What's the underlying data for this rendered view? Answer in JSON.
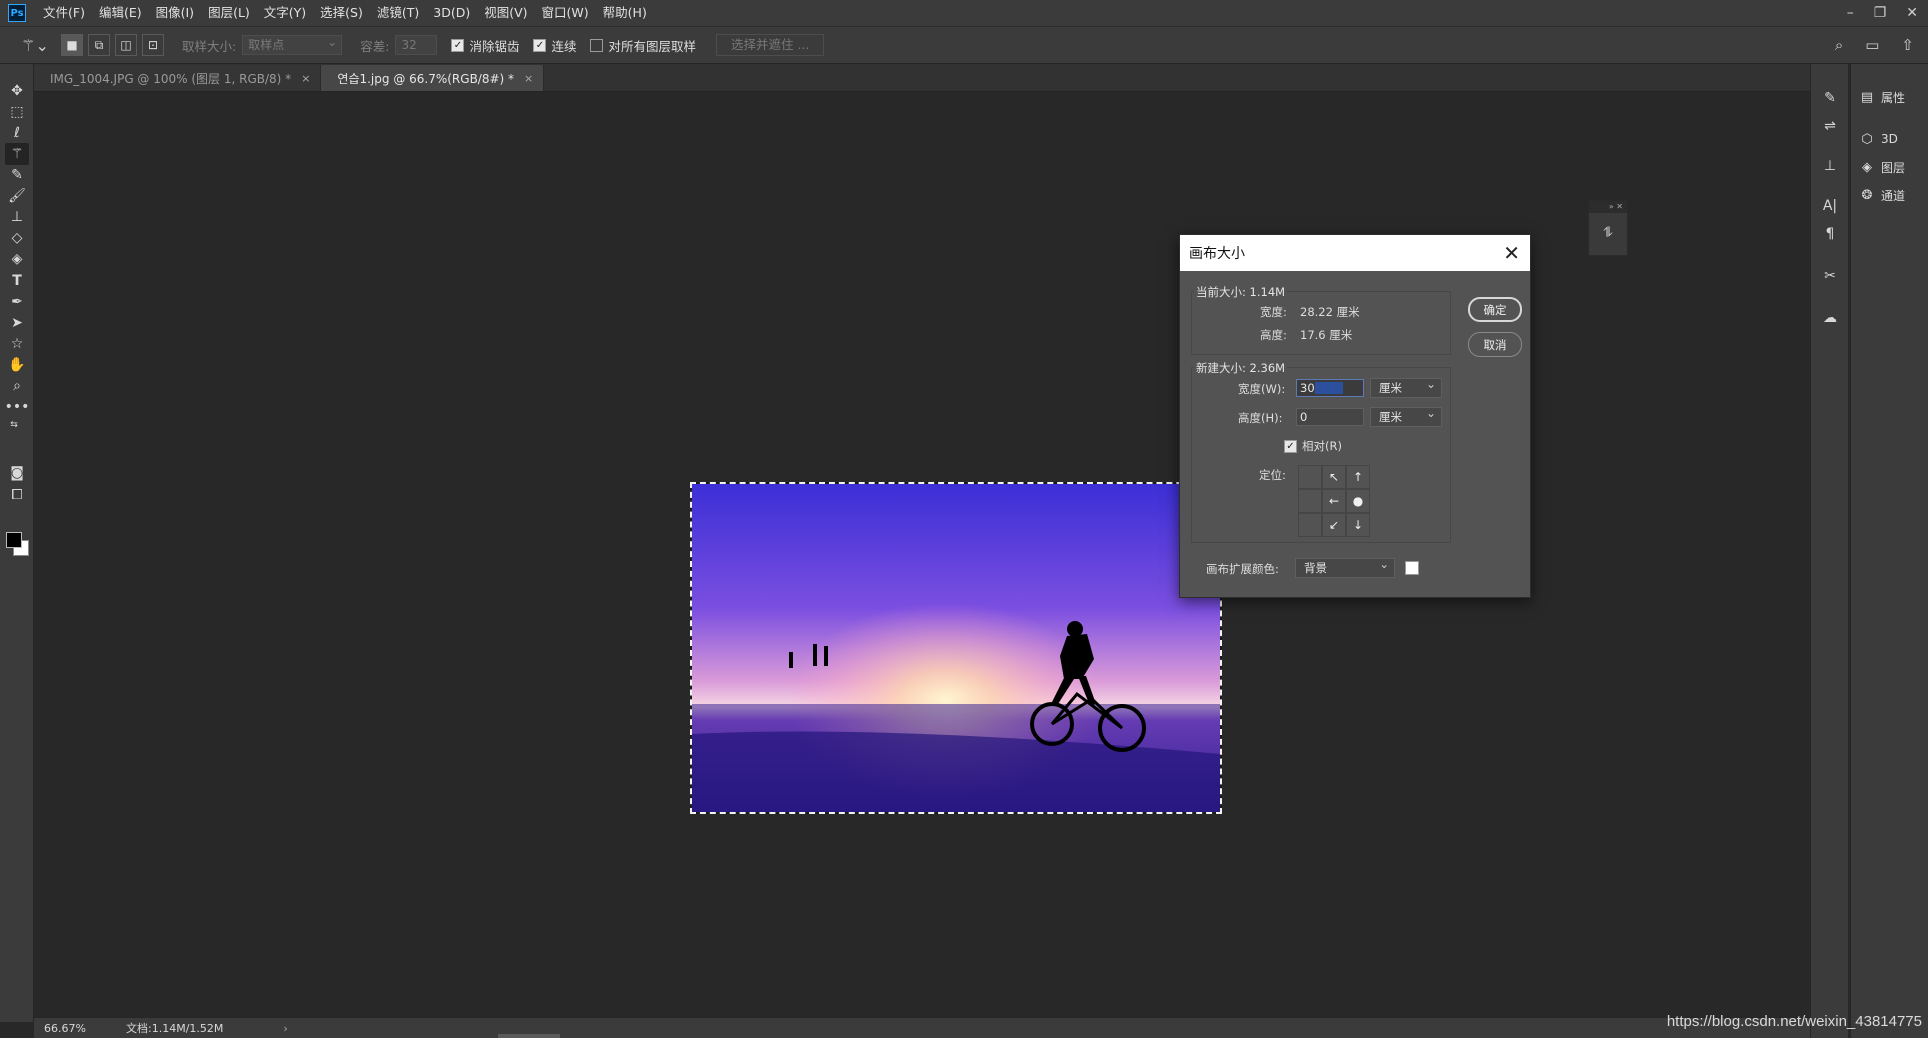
{
  "app": {
    "logo": "Ps"
  },
  "menu": [
    "文件(F)",
    "编辑(E)",
    "图像(I)",
    "图层(L)",
    "文字(Y)",
    "选择(S)",
    "滤镜(T)",
    "3D(D)",
    "视图(V)",
    "窗口(W)",
    "帮助(H)"
  ],
  "options": {
    "sample_size_label": "取样大小:",
    "sample_size_value": "取样点",
    "tolerance_label": "容差:",
    "tolerance_value": "32",
    "antialias_label": "消除锯齿",
    "contiguous_label": "连续",
    "all_layers_label": "对所有图层取样",
    "select_mask_label": "选择并遮住 ..."
  },
  "tabs": [
    {
      "label": "IMG_1004.JPG @ 100% (图层 1, RGB/8) *",
      "close": "×"
    },
    {
      "label": "연습1.jpg @ 66.7%(RGB/8#) *",
      "close": "×"
    }
  ],
  "right_panel": {
    "properties": "属性",
    "three_d": "3D",
    "layers": "图层",
    "channels": "通道"
  },
  "status": {
    "zoom": "66.67%",
    "doc": "文档:1.14M/1.52M",
    "arrow": "›"
  },
  "watermark": "https://blog.csdn.net/weixin_43814775",
  "dialog": {
    "title": "画布大小",
    "ok": "确定",
    "cancel": "取消",
    "current_size": "当前大小: 1.14M",
    "current_width_label": "宽度:",
    "current_width_value": "28.22 厘米",
    "current_height_label": "高度:",
    "current_height_value": "17.6 厘米",
    "new_size": "新建大小: 2.36M",
    "width_label": "宽度(W):",
    "width_value": "30",
    "height_label": "高度(H):",
    "height_value": "0",
    "unit": "厘米",
    "relative_label": "相对(R)",
    "anchor_label": "定位:",
    "ext_color_label": "画布扩展颜色:",
    "ext_color_value": "背景"
  },
  "colors": {
    "foreground": "#000000",
    "background": "#ffffff",
    "accent": "#31a8ff"
  }
}
